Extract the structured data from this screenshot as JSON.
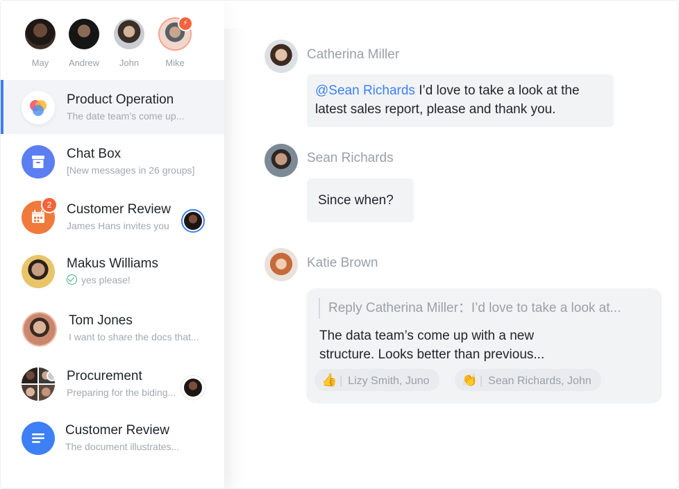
{
  "contacts": [
    {
      "name": "May"
    },
    {
      "name": "Andrew"
    },
    {
      "name": "John"
    },
    {
      "name": "Mike",
      "badge_icon": "lightning-icon"
    }
  ],
  "conversations": [
    {
      "title": "Product Operation",
      "subtitle": "The date team’s come up...",
      "active": true,
      "icon": "color-circles-icon"
    },
    {
      "title": "Chat Box",
      "subtitle": "[New messages in 26 groups]",
      "icon": "archive-box-icon"
    },
    {
      "title": "Customer Review",
      "subtitle": "James Hans invites you",
      "badge": "2",
      "icon": "calendar-icon"
    },
    {
      "title": "Makus Williams",
      "subtitle": "yes please!",
      "status_icon": "check-circle-icon"
    },
    {
      "title": "Tom Jones",
      "subtitle": "I want to share the docs that..."
    },
    {
      "title": "Procurement",
      "subtitle": "Preparing for the biding..."
    },
    {
      "title": "Customer Review",
      "subtitle": "The document illustrates...",
      "icon": "document-lines-icon"
    }
  ],
  "messages": [
    {
      "sender": "Catherina Miller",
      "mention": "@Sean Richards",
      "text_line1": " I’d love to take a look at the",
      "text_line2": "latest sales report, please and thank you."
    },
    {
      "sender": "Sean Richards",
      "text": "Since when?"
    },
    {
      "sender": "Katie Brown",
      "reply": "Reply Catherina Miller：I’d love to take a look at...",
      "text_line1": "The data team’s come up with a new",
      "text_line2": "structure. Looks better than previous...",
      "reactions": [
        {
          "emoji": "👍",
          "emoji_icon": "thumbs-up-icon",
          "people": "Lizy Smith, Juno"
        },
        {
          "emoji": "👏",
          "emoji_icon": "clapping-hands-icon",
          "people": "Sean Richards, John"
        }
      ]
    }
  ],
  "colors": {
    "accent": "#3d7ff5",
    "badge": "#f4643c",
    "chat_box_icon": "#5b7ff0",
    "calendar_icon": "#f07a3b",
    "doc_icon": "#3d7ff5",
    "check": "#39b37a"
  }
}
